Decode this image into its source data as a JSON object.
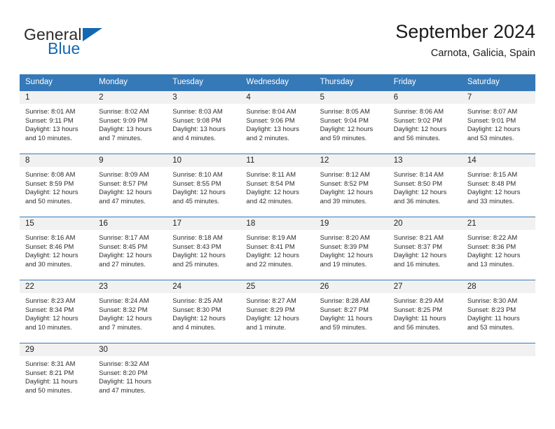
{
  "brand": {
    "name_part1": "General",
    "name_part2": "Blue",
    "icon": "triangle-icon",
    "accent_color": "#1268b3"
  },
  "header": {
    "month_title": "September 2024",
    "location": "Carnota, Galicia, Spain"
  },
  "colors": {
    "header_blue": "#3579b8",
    "day_band_gray": "#f1f1f1",
    "text": "#2e2e2e"
  },
  "weekdays": [
    "Sunday",
    "Monday",
    "Tuesday",
    "Wednesday",
    "Thursday",
    "Friday",
    "Saturday"
  ],
  "weeks": [
    [
      {
        "day": "1",
        "sunrise": "Sunrise: 8:01 AM",
        "sunset": "Sunset: 9:11 PM",
        "daylight_line1": "Daylight: 13 hours",
        "daylight_line2": "and 10 minutes."
      },
      {
        "day": "2",
        "sunrise": "Sunrise: 8:02 AM",
        "sunset": "Sunset: 9:09 PM",
        "daylight_line1": "Daylight: 13 hours",
        "daylight_line2": "and 7 minutes."
      },
      {
        "day": "3",
        "sunrise": "Sunrise: 8:03 AM",
        "sunset": "Sunset: 9:08 PM",
        "daylight_line1": "Daylight: 13 hours",
        "daylight_line2": "and 4 minutes."
      },
      {
        "day": "4",
        "sunrise": "Sunrise: 8:04 AM",
        "sunset": "Sunset: 9:06 PM",
        "daylight_line1": "Daylight: 13 hours",
        "daylight_line2": "and 2 minutes."
      },
      {
        "day": "5",
        "sunrise": "Sunrise: 8:05 AM",
        "sunset": "Sunset: 9:04 PM",
        "daylight_line1": "Daylight: 12 hours",
        "daylight_line2": "and 59 minutes."
      },
      {
        "day": "6",
        "sunrise": "Sunrise: 8:06 AM",
        "sunset": "Sunset: 9:02 PM",
        "daylight_line1": "Daylight: 12 hours",
        "daylight_line2": "and 56 minutes."
      },
      {
        "day": "7",
        "sunrise": "Sunrise: 8:07 AM",
        "sunset": "Sunset: 9:01 PM",
        "daylight_line1": "Daylight: 12 hours",
        "daylight_line2": "and 53 minutes."
      }
    ],
    [
      {
        "day": "8",
        "sunrise": "Sunrise: 8:08 AM",
        "sunset": "Sunset: 8:59 PM",
        "daylight_line1": "Daylight: 12 hours",
        "daylight_line2": "and 50 minutes."
      },
      {
        "day": "9",
        "sunrise": "Sunrise: 8:09 AM",
        "sunset": "Sunset: 8:57 PM",
        "daylight_line1": "Daylight: 12 hours",
        "daylight_line2": "and 47 minutes."
      },
      {
        "day": "10",
        "sunrise": "Sunrise: 8:10 AM",
        "sunset": "Sunset: 8:55 PM",
        "daylight_line1": "Daylight: 12 hours",
        "daylight_line2": "and 45 minutes."
      },
      {
        "day": "11",
        "sunrise": "Sunrise: 8:11 AM",
        "sunset": "Sunset: 8:54 PM",
        "daylight_line1": "Daylight: 12 hours",
        "daylight_line2": "and 42 minutes."
      },
      {
        "day": "12",
        "sunrise": "Sunrise: 8:12 AM",
        "sunset": "Sunset: 8:52 PM",
        "daylight_line1": "Daylight: 12 hours",
        "daylight_line2": "and 39 minutes."
      },
      {
        "day": "13",
        "sunrise": "Sunrise: 8:14 AM",
        "sunset": "Sunset: 8:50 PM",
        "daylight_line1": "Daylight: 12 hours",
        "daylight_line2": "and 36 minutes."
      },
      {
        "day": "14",
        "sunrise": "Sunrise: 8:15 AM",
        "sunset": "Sunset: 8:48 PM",
        "daylight_line1": "Daylight: 12 hours",
        "daylight_line2": "and 33 minutes."
      }
    ],
    [
      {
        "day": "15",
        "sunrise": "Sunrise: 8:16 AM",
        "sunset": "Sunset: 8:46 PM",
        "daylight_line1": "Daylight: 12 hours",
        "daylight_line2": "and 30 minutes."
      },
      {
        "day": "16",
        "sunrise": "Sunrise: 8:17 AM",
        "sunset": "Sunset: 8:45 PM",
        "daylight_line1": "Daylight: 12 hours",
        "daylight_line2": "and 27 minutes."
      },
      {
        "day": "17",
        "sunrise": "Sunrise: 8:18 AM",
        "sunset": "Sunset: 8:43 PM",
        "daylight_line1": "Daylight: 12 hours",
        "daylight_line2": "and 25 minutes."
      },
      {
        "day": "18",
        "sunrise": "Sunrise: 8:19 AM",
        "sunset": "Sunset: 8:41 PM",
        "daylight_line1": "Daylight: 12 hours",
        "daylight_line2": "and 22 minutes."
      },
      {
        "day": "19",
        "sunrise": "Sunrise: 8:20 AM",
        "sunset": "Sunset: 8:39 PM",
        "daylight_line1": "Daylight: 12 hours",
        "daylight_line2": "and 19 minutes."
      },
      {
        "day": "20",
        "sunrise": "Sunrise: 8:21 AM",
        "sunset": "Sunset: 8:37 PM",
        "daylight_line1": "Daylight: 12 hours",
        "daylight_line2": "and 16 minutes."
      },
      {
        "day": "21",
        "sunrise": "Sunrise: 8:22 AM",
        "sunset": "Sunset: 8:36 PM",
        "daylight_line1": "Daylight: 12 hours",
        "daylight_line2": "and 13 minutes."
      }
    ],
    [
      {
        "day": "22",
        "sunrise": "Sunrise: 8:23 AM",
        "sunset": "Sunset: 8:34 PM",
        "daylight_line1": "Daylight: 12 hours",
        "daylight_line2": "and 10 minutes."
      },
      {
        "day": "23",
        "sunrise": "Sunrise: 8:24 AM",
        "sunset": "Sunset: 8:32 PM",
        "daylight_line1": "Daylight: 12 hours",
        "daylight_line2": "and 7 minutes."
      },
      {
        "day": "24",
        "sunrise": "Sunrise: 8:25 AM",
        "sunset": "Sunset: 8:30 PM",
        "daylight_line1": "Daylight: 12 hours",
        "daylight_line2": "and 4 minutes."
      },
      {
        "day": "25",
        "sunrise": "Sunrise: 8:27 AM",
        "sunset": "Sunset: 8:29 PM",
        "daylight_line1": "Daylight: 12 hours",
        "daylight_line2": "and 1 minute."
      },
      {
        "day": "26",
        "sunrise": "Sunrise: 8:28 AM",
        "sunset": "Sunset: 8:27 PM",
        "daylight_line1": "Daylight: 11 hours",
        "daylight_line2": "and 59 minutes."
      },
      {
        "day": "27",
        "sunrise": "Sunrise: 8:29 AM",
        "sunset": "Sunset: 8:25 PM",
        "daylight_line1": "Daylight: 11 hours",
        "daylight_line2": "and 56 minutes."
      },
      {
        "day": "28",
        "sunrise": "Sunrise: 8:30 AM",
        "sunset": "Sunset: 8:23 PM",
        "daylight_line1": "Daylight: 11 hours",
        "daylight_line2": "and 53 minutes."
      }
    ],
    [
      {
        "day": "29",
        "sunrise": "Sunrise: 8:31 AM",
        "sunset": "Sunset: 8:21 PM",
        "daylight_line1": "Daylight: 11 hours",
        "daylight_line2": "and 50 minutes."
      },
      {
        "day": "30",
        "sunrise": "Sunrise: 8:32 AM",
        "sunset": "Sunset: 8:20 PM",
        "daylight_line1": "Daylight: 11 hours",
        "daylight_line2": "and 47 minutes."
      },
      {
        "day": "",
        "sunrise": "",
        "sunset": "",
        "daylight_line1": "",
        "daylight_line2": ""
      },
      {
        "day": "",
        "sunrise": "",
        "sunset": "",
        "daylight_line1": "",
        "daylight_line2": ""
      },
      {
        "day": "",
        "sunrise": "",
        "sunset": "",
        "daylight_line1": "",
        "daylight_line2": ""
      },
      {
        "day": "",
        "sunrise": "",
        "sunset": "",
        "daylight_line1": "",
        "daylight_line2": ""
      },
      {
        "day": "",
        "sunrise": "",
        "sunset": "",
        "daylight_line1": "",
        "daylight_line2": ""
      }
    ]
  ]
}
